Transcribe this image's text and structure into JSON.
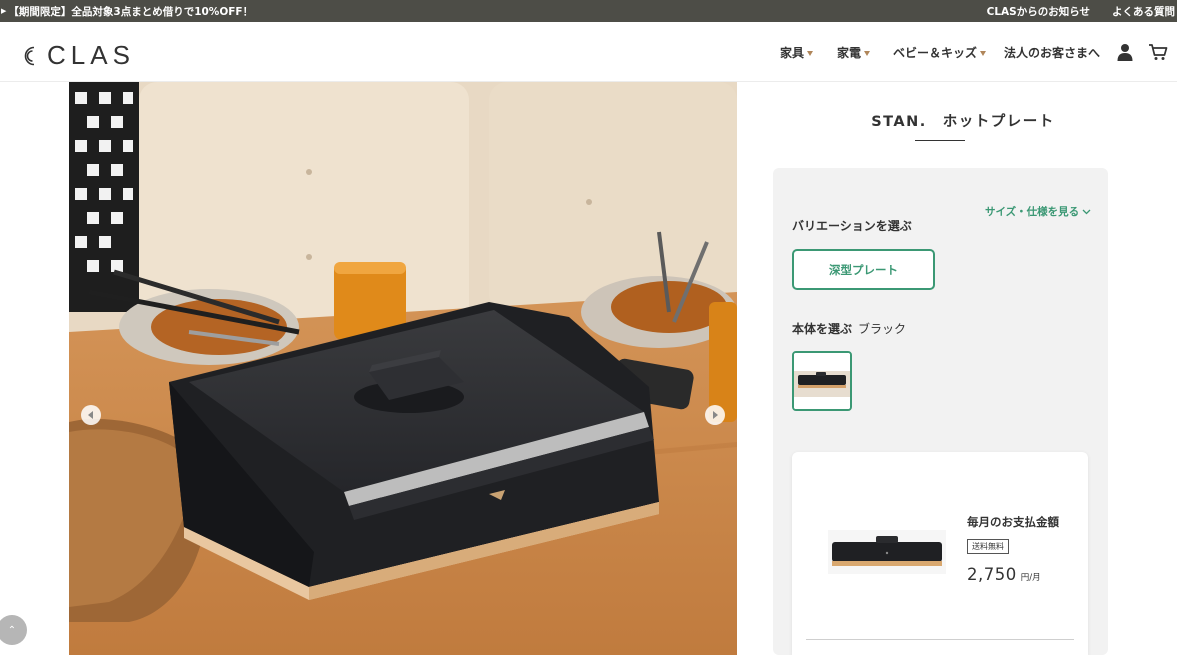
{
  "announcement": {
    "promo_text": "【期間限定】全品対象3点まとめ借りで10%OFF！",
    "links": [
      "CLASからのお知らせ",
      "よくある質問"
    ]
  },
  "header": {
    "logo_text": "CLAS",
    "nav": [
      {
        "label": "家具",
        "has_dropdown": true
      },
      {
        "label": "家電",
        "has_dropdown": true
      },
      {
        "label": "ベビー＆キッズ",
        "has_dropdown": true
      },
      {
        "label": "法人のお客さまへ",
        "has_dropdown": false
      }
    ],
    "icons": [
      "user-icon",
      "cart-icon"
    ]
  },
  "product": {
    "title": "STAN.　ホットプレート",
    "spec_link": "サイズ・仕様を見る",
    "variation_label": "バリエーションを選ぶ",
    "variation_selected": "深型プレート",
    "body_label": "本体を選ぶ",
    "body_color": "ブラック"
  },
  "price_card": {
    "monthly_label": "毎月のお支払金額",
    "badge": "送料無料",
    "amount": "2,750",
    "unit": "円/月"
  },
  "colors": {
    "accent": "#3b9874",
    "announce_bg": "#4d4d47",
    "nav_caret": "#b0865a",
    "panel_bg": "#f2f2f2"
  }
}
